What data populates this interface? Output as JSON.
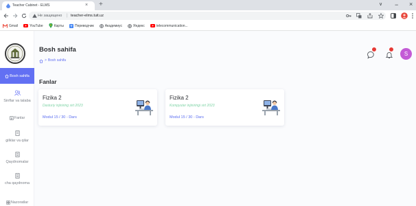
{
  "browser": {
    "tab": {
      "title": "Teacher Cabinet - ELMS",
      "close_label": "×",
      "favicon": "app-favicon-icon"
    },
    "new_tab_label": "+",
    "window_controls": {
      "tab_search": "∨",
      "minimize": "−",
      "close": "×"
    },
    "nav_icons": [
      "back-arrow-icon",
      "forward-arrow-icon",
      "reload-icon"
    ],
    "omnibox": {
      "security_icon": "warning-triangle-icon",
      "security_text": "Не защищено",
      "separator": "|",
      "url": "teacher-elms.tuit.uz"
    },
    "toolbar_icons": [
      "key-icon",
      "translate-icon",
      "share-icon",
      "star-icon",
      "sidebar-icon",
      "profile-icon",
      "menu-icon"
    ],
    "bookmarks": [
      {
        "label": "Gmail",
        "icon": "gmail-icon",
        "color": "#ea4335"
      },
      {
        "label": "YouTube",
        "icon": "youtube-icon",
        "color": "#ff0000"
      },
      {
        "label": "Карты",
        "icon": "maps-pin-icon",
        "color": "#34a853"
      },
      {
        "label": "Переводчик",
        "icon": "translate-icon",
        "color": "#4285f4"
      },
      {
        "label": "Академиус",
        "icon": "globe-icon",
        "color": "#5f6368"
      },
      {
        "label": "Яндекс",
        "icon": "globe-icon",
        "color": "#5f6368"
      },
      {
        "label": "telecommunication...",
        "icon": "youtube-icon",
        "color": "#ff0000"
      }
    ]
  },
  "sidebar": {
    "logo_icon": "university-emblem-icon",
    "items": [
      {
        "label": "Bosh sahifa",
        "icon": "home-icon",
        "active": true
      },
      {
        "label": "Sinflar va talaba",
        "icon": "users-icon"
      },
      {
        "label": "Fanlar",
        "icon": "book-icon"
      },
      {
        "label": "gilklar va qilar",
        "icon": "document-icon"
      },
      {
        "label": "Qaydnomalar",
        "icon": "list-icon"
      },
      {
        "label": "cha qaydnoma",
        "icon": "list-icon"
      },
      {
        "label": "Nazoratlar",
        "icon": "grid-icon"
      }
    ]
  },
  "header": {
    "title": "Bosh sahifa",
    "breadcrumb": {
      "home_icon": "home-icon",
      "separator": ">",
      "current": "Bosh sahifa"
    },
    "icons": [
      "chat-icon",
      "bell-icon"
    ],
    "avatar_letter": "S"
  },
  "section": {
    "title": "Fanlar"
  },
  "cards": [
    {
      "title": "Fizika 2",
      "subtitle": "Dasturiy injiniring sirt 2023",
      "progress": "Modul 15 / 30 - Dars",
      "illustration": "student-at-computer-icon"
    },
    {
      "title": "Fizika 2",
      "subtitle": "Kompyuter injiniringi sirt 2023",
      "progress": "Modul 15 / 30 - Dars",
      "illustration": "student-at-computer-icon"
    }
  ],
  "colors": {
    "accent": "#6270f3",
    "subtitle_green": "#7fd3a6",
    "badge_red": "#e53935",
    "avatar": "#c35bd6"
  }
}
